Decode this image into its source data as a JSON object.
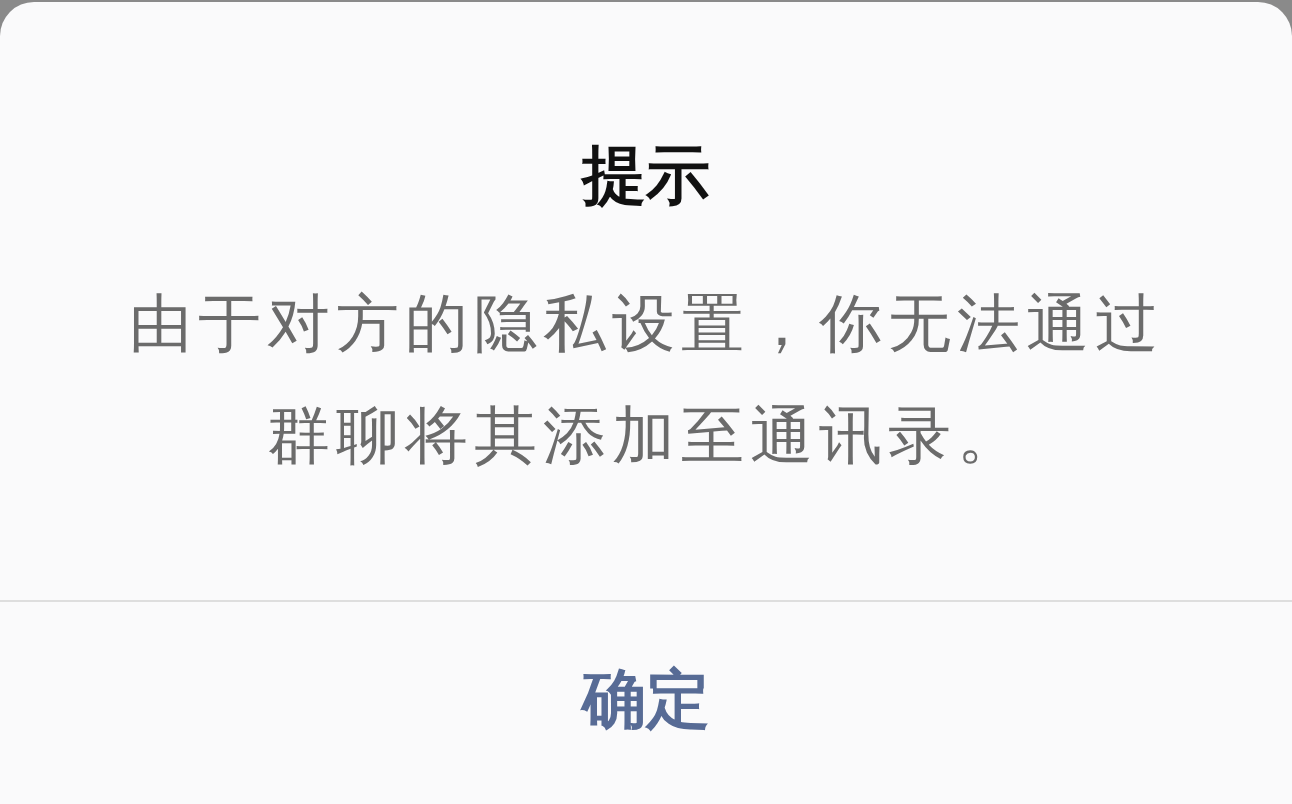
{
  "dialog": {
    "title": "提示",
    "message": "由于对方的隐私设置，你无法通过群聊将其添加至通讯录。",
    "buttons": [
      {
        "label": "确定",
        "kind": "primary"
      }
    ]
  }
}
